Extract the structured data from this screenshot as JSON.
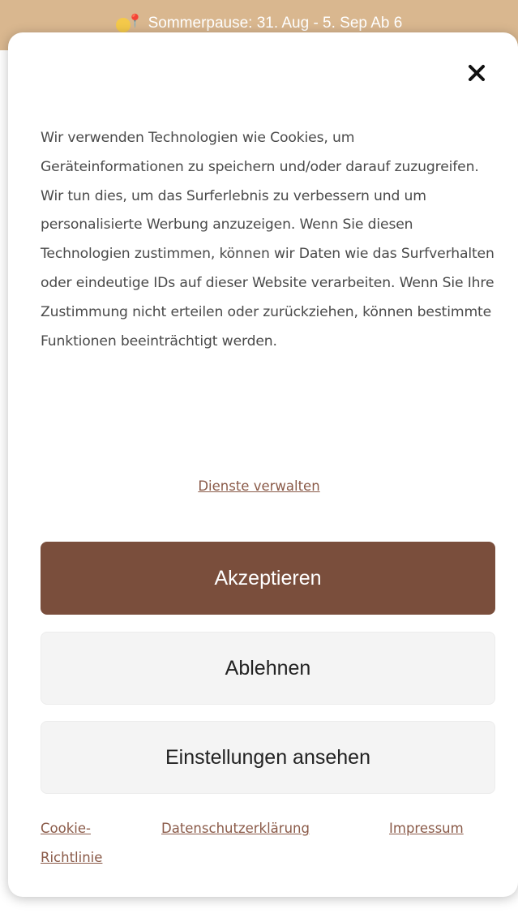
{
  "background": {
    "announcement": "Sommerpause: 31. Aug - 5. Sep Ab 6",
    "footer_partial_text": "...  ...  ...  ..."
  },
  "modal": {
    "close_icon": "close-icon",
    "consent_text": "Wir verwenden Technologien wie Cookies, um Geräteinformationen zu speichern und/oder darauf zuzugreifen. Wir tun dies, um das Surferlebnis zu verbessern und um personalisierte Werbung anzuzeigen. Wenn Sie diesen Technologien zustimmen, können wir Daten wie das Surfverhalten oder eindeutige IDs auf dieser Website verarbeiten. Wenn Sie Ihre Zustimmung nicht erteilen oder zurückziehen, können bestimmte Funktionen beeinträchtigt werden.",
    "manage_services_label": "Dienste verwalten",
    "accept_label": "Akzeptieren",
    "decline_label": "Ablehnen",
    "settings_label": "Einstellungen ansehen",
    "footer_links": {
      "cookie_policy": "Cookie-Richtlinie",
      "privacy_policy": "Datenschutzerklärung",
      "imprint": "Impressum"
    }
  },
  "colors": {
    "accent": "#7a4e3c",
    "link": "#8a5a48",
    "announce_bar": "#d9b78f"
  }
}
